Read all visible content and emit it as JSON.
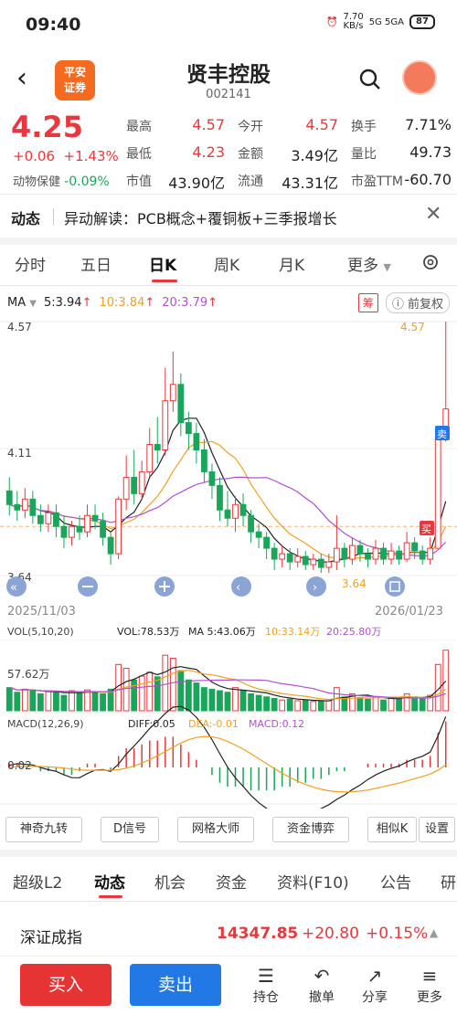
{
  "status": {
    "time": "09:40",
    "net_speed": "7.70\nKB/s",
    "battery": "87",
    "signals": "5G  5GA"
  },
  "header": {
    "name": "贤丰控股",
    "code": "002141",
    "broker_logo": "平安\n证券"
  },
  "quote": {
    "price": "4.25",
    "change": "+0.06",
    "change_pct": "+1.43%",
    "hold_label": "动物保健",
    "hold_pct": "-0.09%",
    "cells": [
      {
        "label": "最高",
        "value": "4.57",
        "color": "red"
      },
      {
        "label": "今开",
        "value": "4.57",
        "color": "red"
      },
      {
        "label": "换手",
        "value": "7.71%",
        "color": "dark"
      },
      {
        "label": "最低",
        "value": "4.23",
        "color": "red"
      },
      {
        "label": "金额",
        "value": "3.49亿",
        "color": "dark"
      },
      {
        "label": "量比",
        "value": "49.73",
        "color": "dark"
      },
      {
        "label": "市值",
        "value": "43.90亿",
        "color": "dark"
      },
      {
        "label": "流通",
        "value": "43.31亿",
        "color": "dark"
      },
      {
        "label": "市盈TTM",
        "value": "-60.70",
        "color": "dark"
      }
    ]
  },
  "news": {
    "tag": "动态",
    "text": "异动解读：PCB概念+覆铜板+三季报增长"
  },
  "tabs": [
    "分时",
    "五日",
    "日K",
    "周K",
    "月K",
    "更多"
  ],
  "active_tab": "日K",
  "ma": {
    "label": "MA",
    "ma5": "5:3.94",
    "ma10": "10:3.84",
    "ma20": "20:3.79",
    "chip": "筹",
    "adj": "前复权"
  },
  "chart": {
    "price_high": "4.57",
    "price_mid": "4.11",
    "price_low": "3.64",
    "max_mark": "4.57",
    "min_mark": "3.64",
    "date_start": "2025/11/03",
    "date_end": "2026/01/23",
    "sell_tag": "卖",
    "buy_tag": "买",
    "vol_header": "VOL(5,10,20)",
    "vol_val": "VOL:78.53万",
    "vol_ma5": "MA 5:43.06万",
    "vol_ma10": "10:33.14万",
    "vol_ma20": "20:25.80万",
    "vol_axis": "57.62万",
    "macd_header": "MACD(12,26,9)",
    "diff": "DIFF:0.05",
    "dea": "DEA:-0.01",
    "macd": "MACD:0.12",
    "macd_axis": "0.02"
  },
  "colors": {
    "up": "#e8383d",
    "down": "#1aa65a",
    "ma5": "#222222",
    "ma10": "#f0a020",
    "ma20": "#b050d0"
  },
  "indicator_buttons": [
    "神奇九转",
    "D信号",
    "网格大师",
    "资金博弈",
    "相似K",
    "设置"
  ],
  "bottom_tabs": [
    "超级L2",
    "动态",
    "机会",
    "资金",
    "资料(F10)",
    "公告",
    "研"
  ],
  "active_bottom_tab": "动态",
  "index": {
    "name": "深证成指",
    "value": "14347.85",
    "change": "+20.80",
    "pct": "+0.15%"
  },
  "actions": {
    "buy": "买入",
    "sell": "卖出",
    "items": [
      "持仓",
      "撤单",
      "分享",
      "更多"
    ]
  },
  "chart_data": {
    "type": "candlestick",
    "ylim": [
      3.64,
      4.57
    ],
    "candles": [
      [
        3.95,
        3.9,
        4.0,
        3.86
      ],
      [
        3.9,
        3.88,
        3.95,
        3.84
      ],
      [
        3.88,
        3.92,
        3.96,
        3.85
      ],
      [
        3.92,
        3.86,
        3.95,
        3.83
      ],
      [
        3.86,
        3.83,
        3.9,
        3.8
      ],
      [
        3.83,
        3.87,
        3.9,
        3.8
      ],
      [
        3.87,
        3.82,
        3.9,
        3.78
      ],
      [
        3.82,
        3.78,
        3.86,
        3.74
      ],
      [
        3.78,
        3.82,
        3.84,
        3.75
      ],
      [
        3.82,
        3.8,
        3.86,
        3.77
      ],
      [
        3.8,
        3.86,
        3.9,
        3.78
      ],
      [
        3.86,
        3.84,
        3.9,
        3.81
      ],
      [
        3.84,
        3.78,
        3.87,
        3.75
      ],
      [
        3.78,
        3.72,
        3.8,
        3.68
      ],
      [
        3.72,
        3.92,
        3.93,
        3.7
      ],
      [
        3.92,
        4.0,
        4.08,
        3.88
      ],
      [
        4.0,
        3.94,
        4.1,
        3.9
      ],
      [
        3.94,
        4.02,
        4.06,
        3.92
      ],
      [
        4.02,
        4.12,
        4.18,
        4.0
      ],
      [
        4.12,
        4.1,
        4.22,
        4.05
      ],
      [
        4.1,
        4.28,
        4.4,
        4.08
      ],
      [
        4.28,
        4.34,
        4.46,
        4.24
      ],
      [
        4.34,
        4.2,
        4.38,
        4.15
      ],
      [
        4.2,
        4.16,
        4.24,
        4.1
      ],
      [
        4.16,
        4.1,
        4.2,
        4.05
      ],
      [
        4.1,
        4.02,
        4.14,
        3.98
      ],
      [
        4.02,
        3.97,
        4.05,
        3.92
      ],
      [
        3.97,
        3.88,
        4.0,
        3.84
      ],
      [
        3.88,
        3.85,
        3.95,
        3.82
      ],
      [
        3.85,
        3.9,
        3.93,
        3.8
      ],
      [
        3.9,
        3.86,
        3.94,
        3.82
      ],
      [
        3.86,
        3.8,
        3.88,
        3.76
      ],
      [
        3.8,
        3.78,
        3.83,
        3.74
      ],
      [
        3.78,
        3.74,
        3.8,
        3.7
      ],
      [
        3.74,
        3.7,
        3.76,
        3.66
      ],
      [
        3.7,
        3.72,
        3.75,
        3.67
      ],
      [
        3.72,
        3.69,
        3.74,
        3.66
      ],
      [
        3.69,
        3.71,
        3.74,
        3.67
      ],
      [
        3.71,
        3.68,
        3.73,
        3.66
      ],
      [
        3.68,
        3.7,
        3.72,
        3.66
      ],
      [
        3.7,
        3.67,
        3.72,
        3.65
      ],
      [
        3.67,
        3.69,
        3.72,
        3.65
      ],
      [
        3.69,
        3.74,
        3.86,
        3.66
      ],
      [
        3.74,
        3.7,
        3.76,
        3.67
      ],
      [
        3.7,
        3.75,
        3.78,
        3.68
      ],
      [
        3.75,
        3.72,
        3.77,
        3.69
      ],
      [
        3.72,
        3.7,
        3.74,
        3.67
      ],
      [
        3.7,
        3.74,
        3.77,
        3.68
      ],
      [
        3.74,
        3.7,
        3.76,
        3.68
      ],
      [
        3.7,
        3.73,
        3.76,
        3.68
      ],
      [
        3.73,
        3.7,
        3.75,
        3.68
      ],
      [
        3.7,
        3.76,
        3.8,
        3.69
      ],
      [
        3.76,
        3.73,
        3.78,
        3.7
      ],
      [
        3.73,
        3.7,
        3.75,
        3.68
      ],
      [
        3.7,
        3.74,
        3.78,
        3.68
      ],
      [
        3.74,
        4.14,
        4.14,
        3.74
      ],
      [
        4.14,
        4.25,
        4.57,
        4.13
      ]
    ],
    "volume": [
      30,
      24,
      28,
      26,
      22,
      25,
      24,
      20,
      26,
      23,
      27,
      24,
      22,
      28,
      60,
      55,
      40,
      45,
      50,
      44,
      72,
      68,
      52,
      40,
      36,
      30,
      28,
      26,
      24,
      30,
      26,
      22,
      20,
      18,
      16,
      14,
      15,
      13,
      14,
      12,
      12,
      13,
      30,
      18,
      22,
      17,
      15,
      18,
      14,
      16,
      15,
      22,
      18,
      16,
      20,
      60,
      78.53
    ],
    "macd_bars": [
      0.01,
      0.01,
      0.0,
      0.0,
      -0.01,
      -0.01,
      -0.01,
      -0.02,
      -0.02,
      -0.01,
      0.01,
      0.01,
      0.0,
      -0.01,
      0.03,
      0.05,
      0.05,
      0.06,
      0.07,
      0.07,
      0.08,
      0.08,
      0.06,
      0.04,
      0.02,
      0.0,
      -0.02,
      -0.04,
      -0.05,
      -0.05,
      -0.05,
      -0.06,
      -0.06,
      -0.06,
      -0.06,
      -0.05,
      -0.05,
      -0.04,
      -0.04,
      -0.03,
      -0.03,
      -0.02,
      -0.01,
      -0.01,
      0.0,
      0.0,
      0.01,
      0.01,
      0.01,
      0.01,
      0.01,
      0.02,
      0.02,
      0.02,
      0.03,
      0.09,
      0.12
    ]
  }
}
